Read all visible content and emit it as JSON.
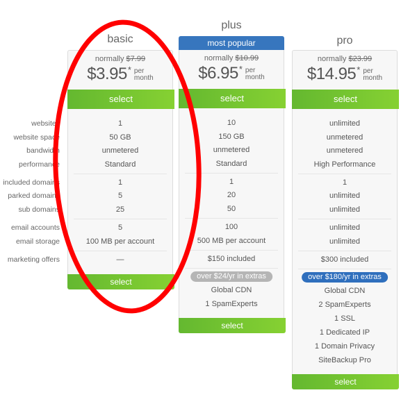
{
  "feature_labels": [
    "websites",
    "website space",
    "bandwidth",
    "performance",
    "included domains",
    "parked domains",
    "sub domains",
    "email accounts",
    "email storage",
    "marketing offers"
  ],
  "plans": [
    {
      "name": "basic",
      "badge": "",
      "normally_label": "normally",
      "old_price": "$7.99",
      "price": "$3.95",
      "asterisk": "*",
      "per": "per",
      "month": "month",
      "select_label": "select",
      "features": [
        "1",
        "50 GB",
        "unmetered",
        "Standard",
        "1",
        "5",
        "25",
        "5",
        "100 MB per account",
        "—"
      ],
      "extras_pill": "",
      "extras": [],
      "bottom_select_label": "select"
    },
    {
      "name": "plus",
      "badge": "most popular",
      "normally_label": "normally",
      "old_price": "$10.99",
      "price": "$6.95",
      "asterisk": "*",
      "per": "per",
      "month": "month",
      "select_label": "select",
      "features": [
        "10",
        "150 GB",
        "unmetered",
        "Standard",
        "1",
        "20",
        "50",
        "100",
        "500 MB per account",
        "$150 included"
      ],
      "extras_pill": "over $24/yr in extras",
      "extras": [
        "Global CDN",
        "1 SpamExperts"
      ],
      "bottom_select_label": "select"
    },
    {
      "name": "pro",
      "badge": "",
      "normally_label": "normally",
      "old_price": "$23.99",
      "price": "$14.95",
      "asterisk": "*",
      "per": "per",
      "month": "month",
      "select_label": "select",
      "features": [
        "unlimited",
        "unmetered",
        "unmetered",
        "High Performance",
        "1",
        "unlimited",
        "unlimited",
        "unlimited",
        "unlimited",
        "$300 included"
      ],
      "extras_pill": "over $180/yr in extras",
      "extras": [
        "Global CDN",
        "2 SpamExperts",
        "1 SSL",
        "1 Dedicated IP",
        "1 Domain Privacy",
        "SiteBackup Pro"
      ],
      "bottom_select_label": "select"
    }
  ],
  "colors": {
    "select_green_start": "#64b830",
    "select_green_end": "#86d132",
    "popular_blue": "#3776be",
    "pill_grey": "#b5b5b5",
    "pill_blue": "#2f6fbd",
    "annotation_red": "#ff0000"
  },
  "annotation": {
    "shape": "ellipse",
    "target": "basic plan"
  }
}
